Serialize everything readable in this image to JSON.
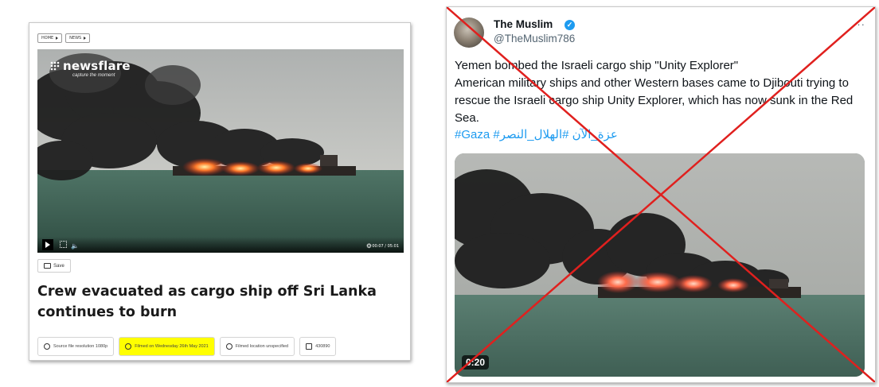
{
  "left": {
    "breadcrumbs": [
      "HOME",
      "NEWS"
    ],
    "logo": "newsflare",
    "logo_tagline": "capture the moment",
    "video_time": "00:07 / 05:01",
    "save_label": "Save",
    "headline": "Crew evacuated as cargo ship off Sri Lanka continues to burn",
    "meta": {
      "resolution": "Source file resolution 1080p",
      "filmed_on": "Filmed on Wednesday 26th May 2021",
      "location": "Filmed location unspecified",
      "id": "430890"
    },
    "colors": {
      "highlight": "#ffff00"
    }
  },
  "right": {
    "display_name": "The Muslim",
    "handle": "@TheMuslim786",
    "more_label": "··",
    "verified_icon": "verified-badge-icon",
    "text": "Yemen bombed the Israeli cargo ship \"Unity Explorer\"\n American military ships and other Western bases came to Djibouti trying to rescue the Israeli cargo ship Unity Explorer, which has now sunk in the Red Sea.",
    "hashtags": "#Gaza #عزة_الآن #الهلال_النصر",
    "video_duration": "0:20",
    "colors": {
      "link": "#1d9bf0",
      "cross": "#e0201e"
    }
  }
}
